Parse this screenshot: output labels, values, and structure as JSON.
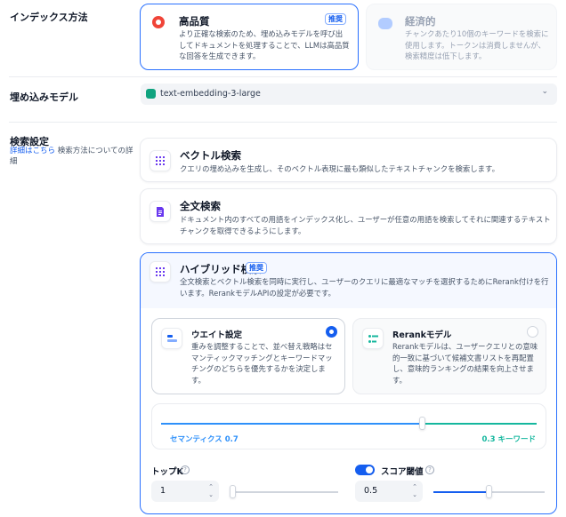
{
  "index_method": {
    "label": "インデックス方法",
    "high_quality": {
      "title": "高品質",
      "badge": "推奨",
      "description": "より正確な検索のため、埋め込みモデルを呼び出してドキュメントを処理することで、LLMは高品質な回答を生成できます。",
      "icon": "orange-star-icon"
    },
    "economy": {
      "title": "経済的",
      "description": "チャンクあたり10個のキーワードを検索に使用します。トークンは消費しませんが、検索精度は低下します。",
      "icon": "piggy-bank-icon"
    }
  },
  "embedding_model": {
    "label": "埋め込みモデル",
    "value": "text-embedding-3-large",
    "icon": "openai-icon"
  },
  "search_settings": {
    "label": "検索設定",
    "link": "詳細はこちら",
    "link_suffix": " 検索方法についての詳細",
    "vector": {
      "title": "ベクトル検索",
      "description": "クエリの埋め込みを生成し、そのベクトル表現に最も類似したテキストチャンクを検索します。"
    },
    "fulltext": {
      "title": "全文検索",
      "description": "ドキュメント内のすべての用語をインデックス化し、ユーザーが任意の用語を検索してそれに関連するテキストチャンクを取得できるようにします。"
    },
    "hybrid": {
      "title": "ハイブリッド検索",
      "badge": "推奨",
      "description": "全文検索とベクトル検索を同時に実行し、ユーザーのクエリに最適なマッチを選択するためにRerank付けを行います。RerankモデルAPIの設定が必要です。",
      "weight": {
        "title": "ウエイト設定",
        "description": "重みを調整することで、並べ替え戦略はセマンティックマッチングとキーワードマッチングのどちらを優先するかを決定します。",
        "selected": true
      },
      "rerank": {
        "title": "Rerankモデル",
        "description": "Rerankモデルは、ユーザークエリとの意味的一致に基づいて候補文書リストを再配置し、意味的ランキングの結果を向上させます。",
        "selected": false
      },
      "semantic_label": "セマンティクス 0.7",
      "keyword_label": "0.3 キーワード",
      "semantic_weight": 0.7,
      "keyword_weight": 0.3,
      "top_k": {
        "label": "トップK",
        "value": "1"
      },
      "score_threshold": {
        "label": "スコア閾値",
        "value": "0.5",
        "enabled": true
      }
    }
  },
  "colors": {
    "accent": "#155eef",
    "teal": "#15b79e",
    "purple": "#6938ef"
  }
}
